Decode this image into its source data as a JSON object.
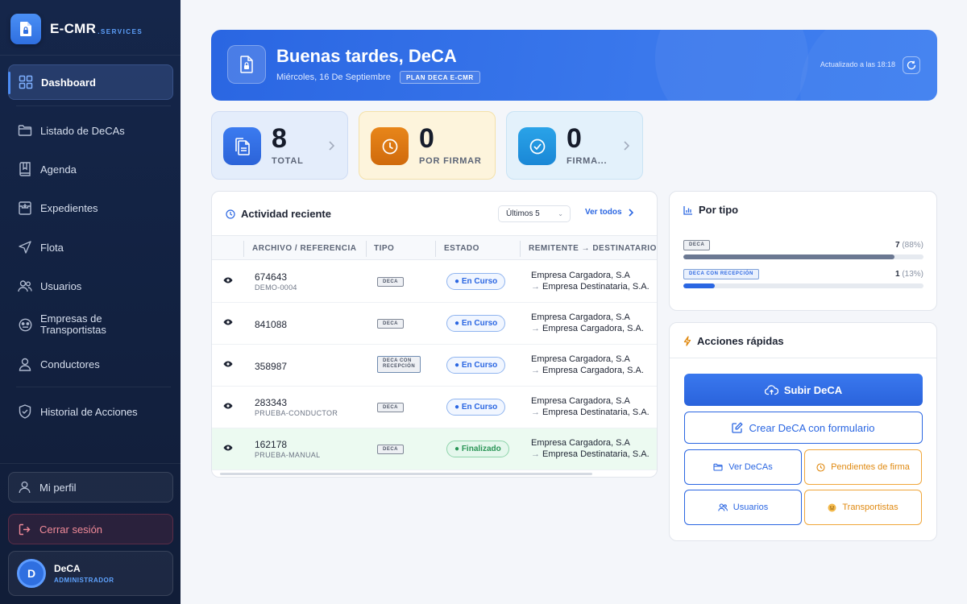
{
  "brand": {
    "name": "E-CMR",
    "suffix": ".SERVICES"
  },
  "sidebar": {
    "items": [
      {
        "label": "Dashboard",
        "icon": "grid-icon",
        "active": true
      },
      {
        "label": "Listado de DeCAs",
        "icon": "folder-icon"
      },
      {
        "label": "Agenda",
        "icon": "book-icon"
      },
      {
        "label": "Expedientes",
        "icon": "archive-icon"
      },
      {
        "label": "Flota",
        "icon": "navigation-icon"
      },
      {
        "label": "Usuarios",
        "icon": "users-icon"
      },
      {
        "label": "Empresas de",
        "label2": "Transportistas",
        "icon": "company-icon"
      },
      {
        "label": "Conductores",
        "icon": "user-icon"
      },
      {
        "label": "Historial de Acciones",
        "icon": "shield-icon"
      }
    ],
    "profile_label": "Mi perfil",
    "logout_label": "Cerrar sesión",
    "user": {
      "initial": "D",
      "name": "DeCA",
      "role": "ADMINISTRADOR"
    }
  },
  "header": {
    "greeting": "Buenas tardes, DeCA",
    "date": "Miércoles, 16 De Septiembre",
    "plan": "PLAN DECA E-CMR",
    "updated": "Actualizado a las 18:18"
  },
  "stats": [
    {
      "value": "8",
      "label": "TOTAL",
      "icon": "documents-icon",
      "color": "#2f6fe0"
    },
    {
      "value": "0",
      "label": "POR FIRMAR",
      "icon": "clock-icon",
      "color": "#e07a14"
    },
    {
      "value": "0",
      "label": "FIRMA...",
      "icon": "check-circle-icon",
      "color": "#1f95df"
    }
  ],
  "activity": {
    "title": "Actividad reciente",
    "filter": "Últimos 5",
    "see_all": "Ver todos",
    "columns": [
      "ARCHIVO / REFERENCIA",
      "TIPO",
      "ESTADO",
      "REMITENTE → DESTINATARIO"
    ],
    "rows": [
      {
        "ref": "674643",
        "sub": "DEMO-0004",
        "tipo": "DECA",
        "estado": "En Curso",
        "remitente": "Empresa Cargadora, S.A",
        "destinatario": "Empresa Destinataria, S.A."
      },
      {
        "ref": "841088",
        "sub": "",
        "tipo": "DECA",
        "estado": "En Curso",
        "remitente": "Empresa Cargadora, S.A",
        "destinatario": "Empresa Cargadora, S.A."
      },
      {
        "ref": "358987",
        "sub": "",
        "tipo": "DECA CON\nRECEPCIÓN",
        "estado": "En Curso",
        "remitente": "Empresa Cargadora, S.A",
        "destinatario": "Empresa Cargadora, S.A."
      },
      {
        "ref": "283343",
        "sub": "PRUEBA-CONDUCTOR",
        "tipo": "DECA",
        "estado": "En Curso",
        "remitente": "Empresa Cargadora, S.A",
        "destinatario": "Empresa Destinataria, S.A."
      },
      {
        "ref": "162178",
        "sub": "PRUEBA-MANUAL",
        "tipo": "DECA",
        "estado": "Finalizado",
        "remitente": "Empresa Cargadora, S.A",
        "destinatario": "Empresa Destinataria, S.A."
      }
    ]
  },
  "by_type": {
    "title": "Por tipo",
    "items": [
      {
        "label": "DECA",
        "count": "7",
        "pct": "(88%)",
        "fraction": 0.88,
        "color": "#6b7892"
      },
      {
        "label": "DECA CON RECEPCIÓN",
        "count": "1",
        "pct": "(13%)",
        "fraction": 0.13,
        "color": "#2a66e2"
      }
    ]
  },
  "quick_actions": {
    "title": "Acciones rápidas",
    "upload": "Subir DeCA",
    "create_form": "Crear DeCA con formulario",
    "view": "Ver DeCAs",
    "pending": "Pendientes de firma",
    "users": "Usuarios",
    "carriers": "Transportistas"
  }
}
